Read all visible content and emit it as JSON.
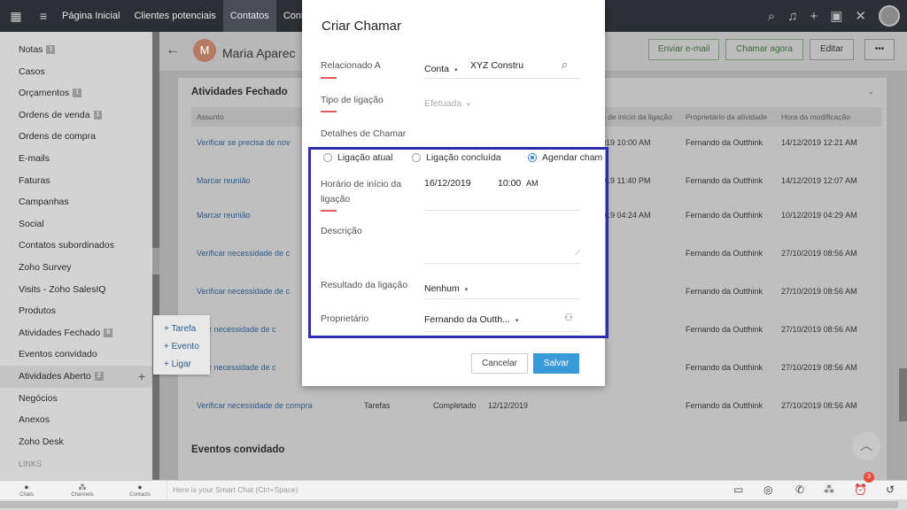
{
  "topnav": {
    "tabs": [
      "Página Inicial",
      "Clientes potenciais",
      "Contatos",
      "Cont"
    ],
    "active_tab": 2
  },
  "sidebar": {
    "items": [
      {
        "label": "Notas",
        "badge": "1"
      },
      {
        "label": "Casos",
        "badge": ""
      },
      {
        "label": "Orçamentos",
        "badge": "1"
      },
      {
        "label": "Ordens de venda",
        "badge": "1"
      },
      {
        "label": "Ordens de compra",
        "badge": ""
      },
      {
        "label": "E-mails",
        "badge": ""
      },
      {
        "label": "Faturas",
        "badge": ""
      },
      {
        "label": "Campanhas",
        "badge": ""
      },
      {
        "label": "Social",
        "badge": ""
      },
      {
        "label": "Contatos subordinados",
        "badge": ""
      },
      {
        "label": "Zoho Survey",
        "badge": ""
      },
      {
        "label": "Visits - Zoho SalesIQ",
        "badge": ""
      },
      {
        "label": "Produtos",
        "badge": ""
      },
      {
        "label": "Atividades Fechado",
        "badge": "8"
      },
      {
        "label": "Eventos convidado",
        "badge": ""
      },
      {
        "label": "Atividades Aberto",
        "badge": "2"
      },
      {
        "label": "Negócios",
        "badge": ""
      },
      {
        "label": "Anexos",
        "badge": ""
      },
      {
        "label": "Zoho Desk",
        "badge": ""
      }
    ],
    "links_label": "LINKS"
  },
  "popover": {
    "items": [
      "+ Tarefa",
      "+ Evento",
      "+ Ligar"
    ]
  },
  "header": {
    "avatar_letter": "M",
    "name": "Maria Aparec",
    "buttons": {
      "email": "Enviar e-mail",
      "call": "Chamar agora",
      "edit": "Editar",
      "more": "•••"
    }
  },
  "closed_activities": {
    "title": "Atividades Fechado",
    "columns": [
      "Assunto",
      "o de início da ligação",
      "Proprietário da atividade",
      "Hora da modificação"
    ],
    "rows": [
      {
        "subject": "Verificar se precisa de nov",
        "start": "019 10:00 AM",
        "owner": "Fernando da Outthink",
        "modified": "14/12/2019 12:21 AM"
      },
      {
        "subject": "Marcar reunião",
        "start": "019 11:40 PM",
        "owner": "Fernando da Outthink",
        "modified": "14/12/2019 12:07 AM"
      },
      {
        "subject": "Marcar reunião",
        "start": "019 04:24 AM",
        "owner": "Fernando da Outthink",
        "modified": "10/12/2019 04:29 AM"
      },
      {
        "subject": "Verificar necessidade de c",
        "start": "",
        "owner": "Fernando da Outthink",
        "modified": "27/10/2019 08:56 AM"
      },
      {
        "subject": "Verificar necessidade de c",
        "start": "",
        "owner": "Fernando da Outthink",
        "modified": "27/10/2019 08:56 AM"
      },
      {
        "subject": "ficar necessidade de c",
        "start": "",
        "owner": "Fernando da Outthink",
        "modified": "27/10/2019 08:56 AM"
      },
      {
        "subject": "ficar necessidade de c",
        "start": "",
        "owner": "Fernando da Outthink",
        "modified": "27/10/2019 08:56 AM"
      },
      {
        "subject": "Verificar necessidade de compra",
        "type": "Tarefas",
        "status": "Completado",
        "date": "12/12/2019",
        "owner": "Fernando da Outthink",
        "modified": "27/10/2019 08:56 AM"
      }
    ]
  },
  "invited_events_title": "Eventos convidado",
  "modal": {
    "title": "Criar Chamar",
    "related_label": "Relacionado A",
    "related_type": "Conta",
    "related_value": "XYZ Constru",
    "call_type_label": "Tipo de ligação",
    "call_type_value": "Efetuada",
    "details_label": "Detalhes de Chamar",
    "radios": [
      "Ligação atual",
      "Ligação concluída",
      "Agendar cham"
    ],
    "radio_selected": 2,
    "start_label": "Horário de início da ligação",
    "start_date": "16/12/2019",
    "start_time": "10:00",
    "start_ampm": "AM",
    "description_label": "Descrição",
    "result_label": "Resultado da ligação",
    "result_value": "Nenhum",
    "owner_label": "Proprietário",
    "owner_value": "Fernando da Outth...",
    "cancel": "Cancelar",
    "save": "Salvar"
  },
  "bottombar": {
    "chats": "Chats",
    "channels": "Channels",
    "contacts": "Contacts",
    "smartchat_placeholder": "Here is your Smart Chat (Ctrl+Space)",
    "notif_count": "3"
  },
  "colors": {
    "highlight": "#2d2fb0",
    "save": "#3a9ad9",
    "link": "#2c5b8a"
  }
}
